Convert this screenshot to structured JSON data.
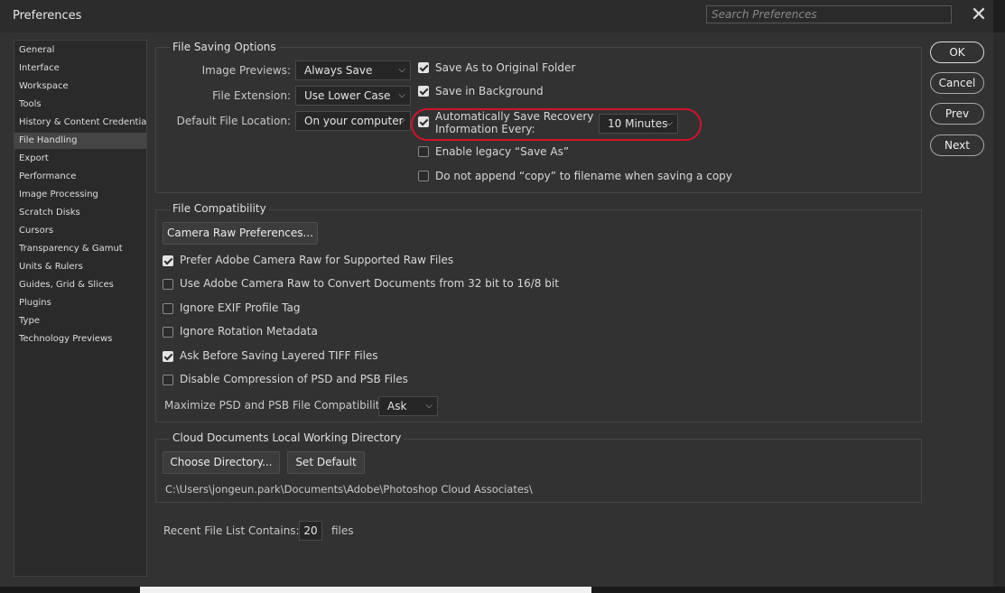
{
  "window": {
    "title": "Preferences",
    "search_placeholder": "Search Preferences",
    "close_label": "✕"
  },
  "sidebar": {
    "items": [
      {
        "label": "General"
      },
      {
        "label": "Interface"
      },
      {
        "label": "Workspace"
      },
      {
        "label": "Tools"
      },
      {
        "label": "History & Content Credentials"
      },
      {
        "label": "File Handling",
        "selected": true
      },
      {
        "label": "Export"
      },
      {
        "label": "Performance"
      },
      {
        "label": "Image Processing"
      },
      {
        "label": "Scratch Disks"
      },
      {
        "label": "Cursors"
      },
      {
        "label": "Transparency & Gamut"
      },
      {
        "label": "Units & Rulers"
      },
      {
        "label": "Guides, Grid & Slices"
      },
      {
        "label": "Plugins"
      },
      {
        "label": "Type"
      },
      {
        "label": "Technology Previews"
      }
    ]
  },
  "file_saving": {
    "title": "File Saving Options",
    "image_previews": {
      "label": "Image Previews:",
      "value": "Always Save"
    },
    "file_extension": {
      "label": "File Extension:",
      "value": "Use Lower Case"
    },
    "default_location": {
      "label": "Default File Location:",
      "value": "On your computer"
    },
    "save_as_original": {
      "label": "Save As to Original Folder",
      "checked": true
    },
    "save_in_background": {
      "label": "Save in Background",
      "checked": true
    },
    "auto_save": {
      "label_line1": "Automatically Save Recovery",
      "label_line2": "Information Every:",
      "checked": true,
      "interval": "10 Minutes"
    },
    "legacy_save_as": {
      "label": "Enable legacy “Save As”",
      "checked": false
    },
    "no_append_copy": {
      "label": "Do not append “copy” to filename when saving a copy",
      "checked": false
    }
  },
  "file_compat": {
    "title": "File Compatibility",
    "camera_raw_button": "Camera Raw Preferences...",
    "options": [
      {
        "label": "Prefer Adobe Camera Raw for Supported Raw Files",
        "checked": true
      },
      {
        "label": "Use Adobe Camera Raw to Convert Documents from 32 bit to 16/8 bit",
        "checked": false
      },
      {
        "label": "Ignore EXIF Profile Tag",
        "checked": false
      },
      {
        "label": "Ignore Rotation Metadata",
        "checked": false
      },
      {
        "label": "Ask Before Saving Layered TIFF Files",
        "checked": true
      },
      {
        "label": "Disable Compression of PSD and PSB Files",
        "checked": false
      }
    ],
    "maximize": {
      "label": "Maximize PSD and PSB File Compatibility:",
      "value": "Ask"
    }
  },
  "cloud": {
    "title": "Cloud Documents Local Working Directory",
    "choose_button": "Choose Directory...",
    "default_button": "Set Default",
    "path": "C:\\Users\\jongeun.park\\Documents\\Adobe\\Photoshop Cloud Associates\\"
  },
  "recent": {
    "label": "Recent File List Contains:",
    "value": "20",
    "unit": "files"
  },
  "buttons": {
    "ok": "OK",
    "cancel": "Cancel",
    "prev": "Prev",
    "next": "Next"
  },
  "colors": {
    "highlight": "#d3122a",
    "dialog_bg": "#323232"
  }
}
